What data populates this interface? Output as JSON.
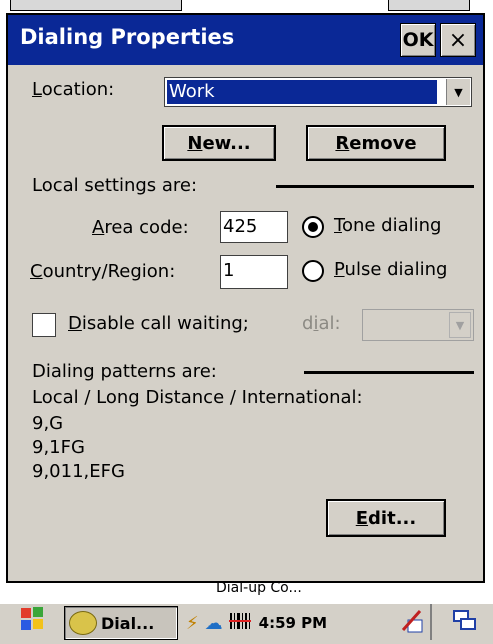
{
  "dialog": {
    "title": "Dialing Properties",
    "ok_label": "OK",
    "close_label": "×"
  },
  "location": {
    "label": "Location:",
    "value": "Work",
    "new_button": "New...",
    "remove_button": "Remove"
  },
  "local_settings": {
    "heading": "Local settings are:",
    "area_code_label": "Area code:",
    "area_code_value": "425",
    "country_label": "Country/Region:",
    "country_value": "1",
    "tone_label": "Tone dialing",
    "pulse_label": "Pulse dialing",
    "tone_selected": true
  },
  "call_waiting": {
    "label": "Disable call waiting;",
    "dial_label": "dial:",
    "checked": false
  },
  "patterns": {
    "heading": "Dialing patterns are:",
    "columns": "Local / Long Distance / International:",
    "local": "9,G",
    "long_distance": "9,1FG",
    "international": "9,011,EFG",
    "edit_button": "Edit..."
  },
  "background_window": {
    "text": "Dial-up Co..."
  },
  "taskbar": {
    "task_label": "Dial...",
    "clock": "4:59 PM",
    "icons": [
      "start-flag-icon",
      "dialer-icon",
      "battery-icon",
      "network-icon",
      "barcode-icon",
      "input-panel-icon",
      "window-switch-icon"
    ]
  }
}
